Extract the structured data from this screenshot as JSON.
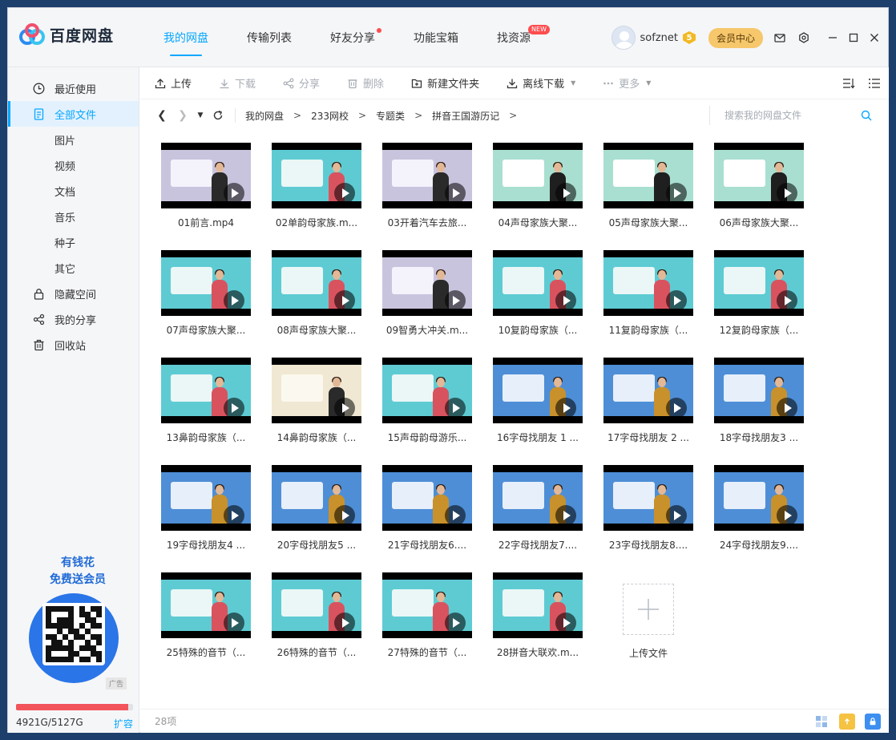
{
  "app": {
    "name": "百度网盘"
  },
  "nav": {
    "tabs": [
      {
        "label": "我的网盘",
        "active": true
      },
      {
        "label": "传输列表"
      },
      {
        "label": "好友分享",
        "dot": true
      },
      {
        "label": "功能宝箱"
      },
      {
        "label": "找资源",
        "badge": "NEW"
      }
    ]
  },
  "user": {
    "name": "sofznet",
    "vip_level": "5",
    "vip_center": "会员中心"
  },
  "sidebar": {
    "items": [
      {
        "label": "最近使用",
        "icon": "clock-icon"
      },
      {
        "label": "全部文件",
        "icon": "document-icon",
        "active": true
      },
      {
        "label": "图片",
        "sub": true
      },
      {
        "label": "视频",
        "sub": true
      },
      {
        "label": "文档",
        "sub": true
      },
      {
        "label": "音乐",
        "sub": true
      },
      {
        "label": "种子",
        "sub": true
      },
      {
        "label": "其它",
        "sub": true
      },
      {
        "label": "隐藏空间",
        "icon": "lock-icon"
      },
      {
        "label": "我的分享",
        "icon": "share-icon"
      },
      {
        "label": "回收站",
        "icon": "trash-icon"
      }
    ],
    "ad": {
      "line1": "有钱花",
      "line2": "免费送会员",
      "tag": "广告",
      "qr_letter": "有"
    },
    "storage": {
      "used": "4921G/5127G",
      "fraction": 0.96,
      "expand": "扩容"
    }
  },
  "toolbar": {
    "upload": "上传",
    "download": "下载",
    "share": "分享",
    "delete": "删除",
    "new_folder": "新建文件夹",
    "offline_download": "离线下载",
    "more": "更多"
  },
  "path": {
    "crumbs": [
      "我的网盘",
      "233网校",
      "专题类",
      "拼音王国游历记"
    ],
    "separator": ">"
  },
  "search": {
    "placeholder": "搜索我的网盘文件"
  },
  "files": [
    {
      "name": "01前言.mp4",
      "theme": "lavender"
    },
    {
      "name": "02单韵母家族.m...",
      "theme": "teal"
    },
    {
      "name": "03开着汽车去旅...",
      "theme": "lavender"
    },
    {
      "name": "04声母家族大聚...",
      "theme": "green"
    },
    {
      "name": "05声母家族大聚...",
      "theme": "green"
    },
    {
      "name": "06声母家族大聚...",
      "theme": "green"
    },
    {
      "name": "07声母家族大聚...",
      "theme": "teal"
    },
    {
      "name": "08声母家族大聚...",
      "theme": "teal"
    },
    {
      "name": "09智勇大冲关.m...",
      "theme": "lavender"
    },
    {
      "name": "10复韵母家族（...",
      "theme": "teal"
    },
    {
      "name": "11复韵母家族（...",
      "theme": "teal"
    },
    {
      "name": "12复韵母家族（...",
      "theme": "teal"
    },
    {
      "name": "13鼻韵母家族（...",
      "theme": "teal"
    },
    {
      "name": "14鼻韵母家族（...",
      "theme": "cream"
    },
    {
      "name": "15声母韵母游乐...",
      "theme": "teal"
    },
    {
      "name": "16字母找朋友 1 ...",
      "theme": "blue"
    },
    {
      "name": "17字母找朋友 2 ...",
      "theme": "blue"
    },
    {
      "name": "18字母找朋友3 ...",
      "theme": "blue"
    },
    {
      "name": "19字母找朋友4 ...",
      "theme": "blue"
    },
    {
      "name": "20字母找朋友5 ...",
      "theme": "blue"
    },
    {
      "name": "21字母找朋友6....",
      "theme": "blue"
    },
    {
      "name": "22字母找朋友7....",
      "theme": "blue"
    },
    {
      "name": "23字母找朋友8....",
      "theme": "blue"
    },
    {
      "name": "24字母找朋友9....",
      "theme": "blue"
    },
    {
      "name": "25特殊的音节（...",
      "theme": "teal"
    },
    {
      "name": "26特殊的音节（...",
      "theme": "teal"
    },
    {
      "name": "27特殊的音节（...",
      "theme": "teal"
    },
    {
      "name": "28拼音大联欢.m...",
      "theme": "teal"
    }
  ],
  "upload_tile": {
    "label": "上传文件"
  },
  "status": {
    "count": "28项"
  },
  "colors": {
    "accent": "#06a7ff",
    "teal": "#5ecbd3",
    "lavender": "#c9c4de",
    "green": "#a9dfd0",
    "blue": "#4e8ed6",
    "cream": "#f0e8d2",
    "storage_bar": "#f2545b"
  }
}
